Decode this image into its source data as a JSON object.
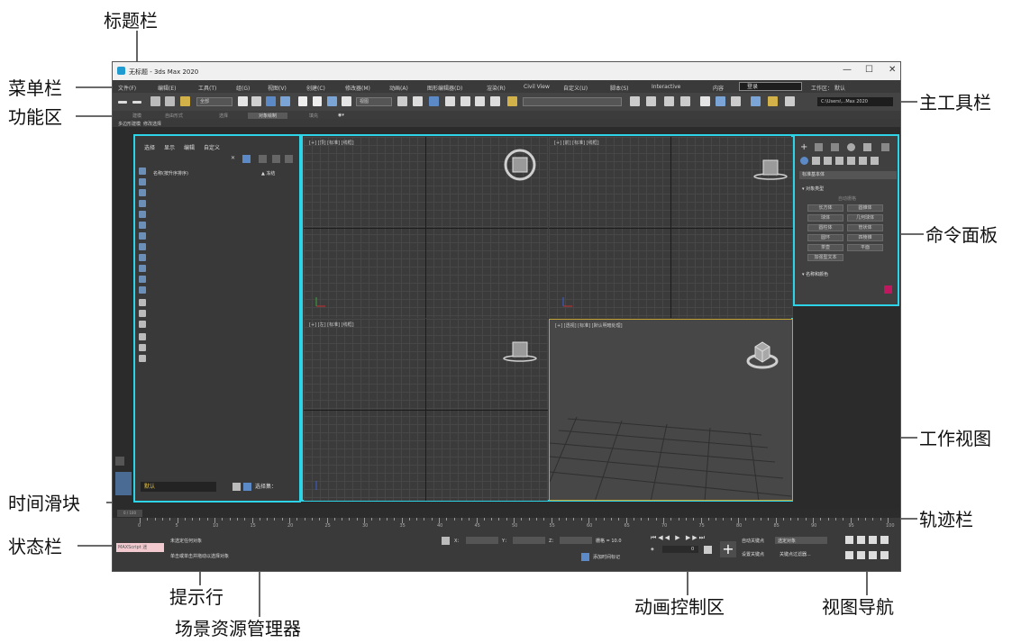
{
  "callouts": {
    "title_bar": "标题栏",
    "menu_bar": "菜单栏",
    "ribbon": "功能区",
    "main_toolbar": "主工具栏",
    "command_panel": "命令面板",
    "work_viewport": "工作视图",
    "time_slider": "时间滑块",
    "track_bar": "轨迹栏",
    "status_bar": "状态栏",
    "prompt_line": "提示行",
    "scene_explorer": "场景资源管理器",
    "animation_controls": "动画控制区",
    "viewport_navigation": "视图导航"
  },
  "window": {
    "title": "无标题 - 3ds Max 2020",
    "controls": {
      "minimize": "—",
      "maximize": "☐",
      "close": "✕"
    }
  },
  "menu": {
    "items": [
      "文件(F)",
      "编辑(E)",
      "工具(T)",
      "组(G)",
      "视图(V)",
      "创建(C)",
      "修改器(M)",
      "动画(A)",
      "图形编辑器(D)",
      "渲染(R)",
      "Civil View",
      "自定义(U)",
      "脚本(S)",
      "Interactive",
      "内容"
    ],
    "signin": "登录",
    "workspace_label": "工作区：",
    "workspace_value": "默认"
  },
  "toolbar": {
    "selection_filter": "全部",
    "view_dropdown": "视图",
    "path": "C:\\Users\\...Max 2020"
  },
  "ribbon": {
    "tabs": [
      "建模",
      "自由形式",
      "选择",
      "对象绘制",
      "填充"
    ],
    "subtabs": [
      "多边形建模",
      "修改选择"
    ]
  },
  "explorer": {
    "tabs": [
      "选择",
      "显示",
      "编辑",
      "自定义"
    ],
    "column_name": "名称(按升序排序)",
    "column_frozen": "▲ 冻结",
    "layer_field": "默认",
    "selection_set_label": "选择集："
  },
  "viewports": [
    {
      "label": "[+] [顶] [标准] [线框]"
    },
    {
      "label": "[+] [前] [标准] [线框]"
    },
    {
      "label": "[+] [左] [标准] [线框]"
    },
    {
      "label": "[+] [透视] [标准] [默认明暗处理]"
    }
  ],
  "command_panel": {
    "category": "标准基本体",
    "section_object_type": "对象类型",
    "autogrid": "自动栅格",
    "buttons": [
      "长方体",
      "圆锥体",
      "球体",
      "几何球体",
      "圆柱体",
      "管状体",
      "圆环",
      "四棱锥",
      "茶壶",
      "平面",
      "加强型文本"
    ],
    "section_name_color": "名称和颜色",
    "object_color": "#c0185f"
  },
  "timeline": {
    "slider": "0 / 100",
    "ticks": [
      "0",
      "5",
      "10",
      "15",
      "20",
      "25",
      "30",
      "35",
      "40",
      "45",
      "50",
      "55",
      "60",
      "65",
      "70",
      "75",
      "80",
      "85",
      "90",
      "95",
      "100"
    ]
  },
  "status": {
    "maxscript": "MAXScript 迷",
    "prompt_top": "未选定任何对象",
    "prompt_bottom": "单击或单击并拖动以选择对象",
    "x_label": "X：",
    "y_label": "Y：",
    "z_label": "Z：",
    "grid": "栅格 = 10.0",
    "add_time_tag": "添加时间标记",
    "auto_key": "自动关键点",
    "set_key": "设置关键点",
    "selected_obj": "选定对象",
    "key_filters": "关键点过滤器...",
    "frame": "0"
  },
  "colors": {
    "highlight_border": "#2dd3e6",
    "accent_blue": "#5b8ac6",
    "active_viewport_border": "#c2a233"
  }
}
